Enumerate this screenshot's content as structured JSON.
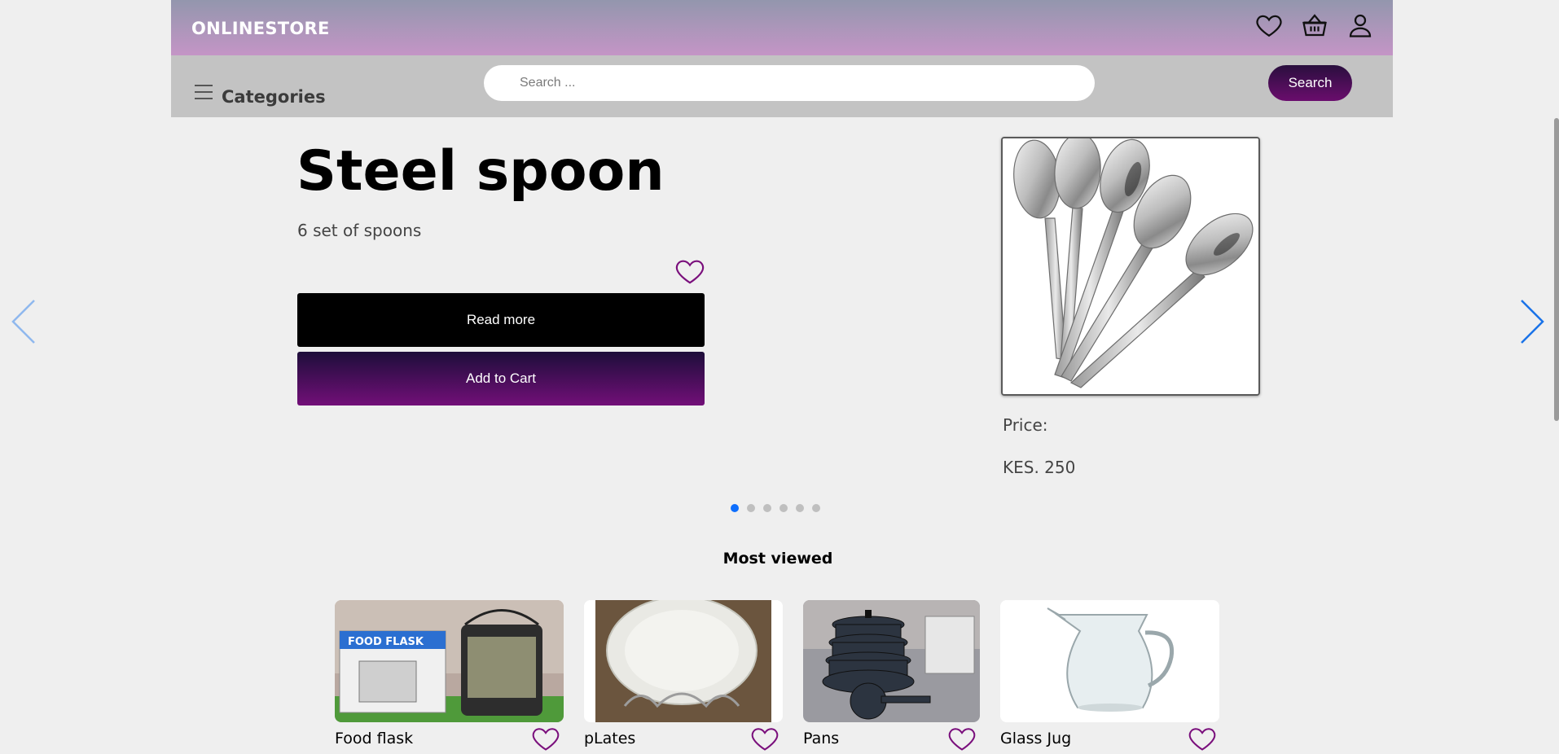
{
  "header": {
    "brand": "ONLINESTORE"
  },
  "nav": {
    "categories_label": "Categories",
    "search_placeholder": "Search ...",
    "search_button": "Search"
  },
  "hero": {
    "title": "Steel spoon",
    "subtitle": "6 set of spoons",
    "read_more": "Read more",
    "add_to_cart": "Add to Cart",
    "price_label": "Price:",
    "price_value": "KES. 250",
    "slide_count": 6,
    "active_slide": 1
  },
  "most_viewed": {
    "title": "Most viewed",
    "items": [
      {
        "name": "Food flask"
      },
      {
        "name": "pLates"
      },
      {
        "name": "Pans"
      },
      {
        "name": "Glass Jug"
      }
    ]
  },
  "colors": {
    "accent": "#6a0d6d",
    "carousel_arrow": "#1a73e8",
    "active_dot": "#0d6efd"
  }
}
